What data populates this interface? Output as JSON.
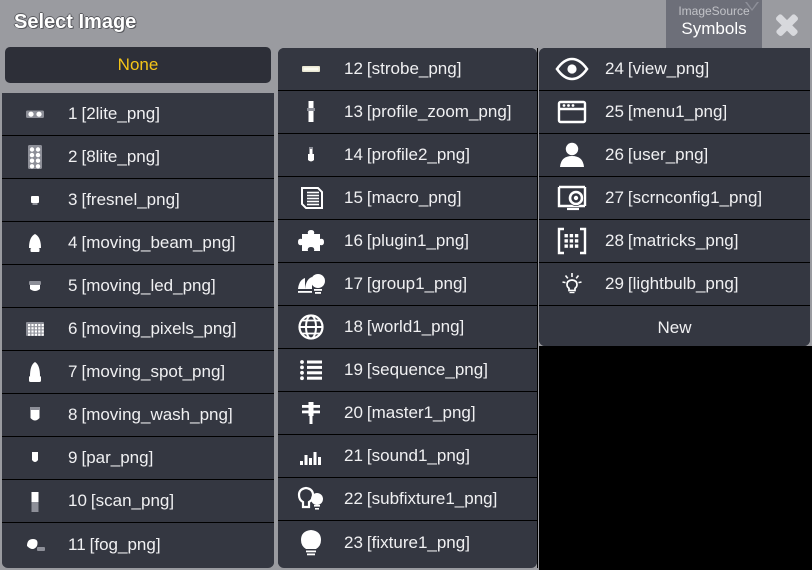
{
  "window": {
    "title": "Select Image",
    "close_icon": "close-x-icon"
  },
  "source_tab": {
    "label": "ImageSource",
    "value": "Symbols",
    "arrow_icon": "chevron-down-icon"
  },
  "none_button": {
    "label": "None"
  },
  "new_button": {
    "label": "New"
  },
  "colors": {
    "titlebar": "#9a9ba0",
    "row_background": "#343741",
    "row_divider": "#000000",
    "accent_yellow": "#f5c518",
    "tab_background": "#6d6f79",
    "text": "#f0f0f2",
    "backdrop": "#000000"
  },
  "columns": [
    {
      "name": "column-1",
      "items": [
        {
          "num": "1",
          "label": "[2lite_png]",
          "icon": "two-lamp-icon"
        },
        {
          "num": "2",
          "label": "[8lite_png]",
          "icon": "eight-lamp-icon"
        },
        {
          "num": "3",
          "label": "[fresnel_png]",
          "icon": "fresnel-icon"
        },
        {
          "num": "4",
          "label": "[moving_beam_png]",
          "icon": "moving-beam-icon"
        },
        {
          "num": "5",
          "label": "[moving_led_png]",
          "icon": "moving-led-icon"
        },
        {
          "num": "6",
          "label": "[moving_pixels_png]",
          "icon": "moving-pixels-icon"
        },
        {
          "num": "7",
          "label": "[moving_spot_png]",
          "icon": "moving-spot-icon"
        },
        {
          "num": "8",
          "label": "[moving_wash_png]",
          "icon": "moving-wash-icon"
        },
        {
          "num": "9",
          "label": "[par_png]",
          "icon": "par-icon"
        },
        {
          "num": "10",
          "label": "[scan_png]",
          "icon": "scan-icon"
        },
        {
          "num": "11",
          "label": "[fog_png]",
          "icon": "fog-icon"
        }
      ]
    },
    {
      "name": "column-2",
      "items": [
        {
          "num": "12",
          "label": "[strobe_png]",
          "icon": "strobe-icon"
        },
        {
          "num": "13",
          "label": "[profile_zoom_png]",
          "icon": "profile-zoom-icon"
        },
        {
          "num": "14",
          "label": "[profile2_png]",
          "icon": "profile2-icon"
        },
        {
          "num": "15",
          "label": "[macro_png]",
          "icon": "macro-scroll-icon"
        },
        {
          "num": "16",
          "label": "[plugin1_png]",
          "icon": "puzzle-piece-icon"
        },
        {
          "num": "17",
          "label": "[group1_png]",
          "icon": "group-bulbs-icon"
        },
        {
          "num": "18",
          "label": "[world1_png]",
          "icon": "globe-icon"
        },
        {
          "num": "19",
          "label": "[sequence_png]",
          "icon": "list-lines-icon"
        },
        {
          "num": "20",
          "label": "[master1_png]",
          "icon": "master-fader-icon"
        },
        {
          "num": "21",
          "label": "[sound1_png]",
          "icon": "sound-bars-icon"
        },
        {
          "num": "22",
          "label": "[subfixture1_png]",
          "icon": "subfixture-bulbs-icon"
        },
        {
          "num": "23",
          "label": "[fixture1_png]",
          "icon": "light-bulb-icon"
        }
      ]
    },
    {
      "name": "column-3",
      "items": [
        {
          "num": "24",
          "label": "[view_png]",
          "icon": "eye-icon"
        },
        {
          "num": "25",
          "label": "[menu1_png]",
          "icon": "window-menu-icon"
        },
        {
          "num": "26",
          "label": "[user_png]",
          "icon": "user-icon"
        },
        {
          "num": "27",
          "label": "[scrnconfig1_png]",
          "icon": "screen-config-gear-icon"
        },
        {
          "num": "28",
          "label": "[matricks_png]",
          "icon": "matrix-grid-icon"
        },
        {
          "num": "29",
          "label": "[lightbulb_png]",
          "icon": "idea-bulb-icon"
        }
      ]
    }
  ]
}
